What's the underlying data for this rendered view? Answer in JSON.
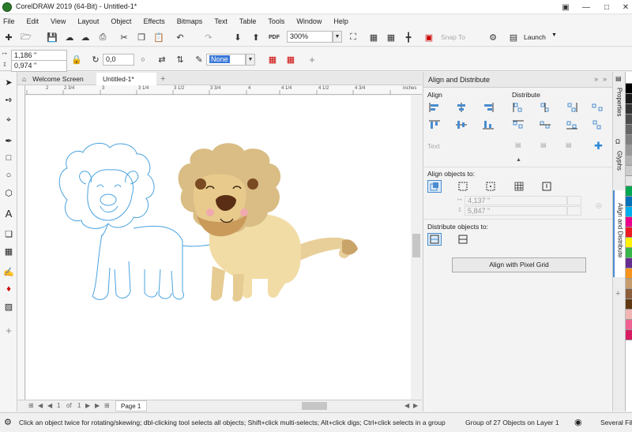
{
  "window": {
    "title": "CorelDRAW 2019 (64-Bit) - Untitled-1*"
  },
  "menu": [
    "File",
    "Edit",
    "View",
    "Layout",
    "Object",
    "Effects",
    "Bitmaps",
    "Text",
    "Table",
    "Tools",
    "Window",
    "Help"
  ],
  "toolbar": {
    "zoom": "300%",
    "snap_to": "Snap To",
    "launch": "Launch"
  },
  "property_bar": {
    "x_value": "1,186 \"",
    "y_value": "0,974 \"",
    "rotation": "0,0",
    "outline": "None"
  },
  "tabs": {
    "welcome": "Welcome Screen",
    "document": "Untitled-1*"
  },
  "ruler": {
    "h_ticks": [
      "2",
      "2 3/4",
      "3",
      "3 1/4",
      "3 1/2",
      "3 3/4",
      "4",
      "4 1/4",
      "4 1/2",
      "4 3/4"
    ],
    "unit": "inches"
  },
  "page_nav": {
    "current": "1",
    "of": "of",
    "total": "1",
    "page_tab": "Page 1"
  },
  "docker": {
    "title": "Align and Distribute",
    "align_label": "Align",
    "distribute_label": "Distribute",
    "text_label": "Text",
    "align_objects_to": "Align objects to:",
    "x_field": "4,137 \"",
    "y_field": "5,847 \"",
    "distribute_objects_to": "Distribute objects to:",
    "pixel_grid_button": "Align with Pixel Grid"
  },
  "side_tabs": [
    "Properties",
    "Glyphs",
    "Align and Distribute"
  ],
  "palette": [
    "#ffffff",
    "#000000",
    "#1a1a1a",
    "#333333",
    "#4d4d4d",
    "#666666",
    "#808080",
    "#999999",
    "#b3b3b3",
    "#cccccc",
    "#e6e6e6",
    "#00a651",
    "#0072bc",
    "#00aeef",
    "#ec008c",
    "#ed1c24",
    "#fff200",
    "#39b54a",
    "#662d91",
    "#f7941d",
    "#c69c6d",
    "#8b5e3c",
    "#603913",
    "#f2b3b3",
    "#f06292",
    "#d81b60"
  ],
  "status": {
    "hint": "Click an object twice for rotating/skewing; dbl-clicking tool selects all objects; Shift+click multi-selects; Alt+click digs; Ctrl+click selects in a group",
    "selection": "Group of 27 Objects on Layer 1",
    "fill": "Several Fil"
  }
}
